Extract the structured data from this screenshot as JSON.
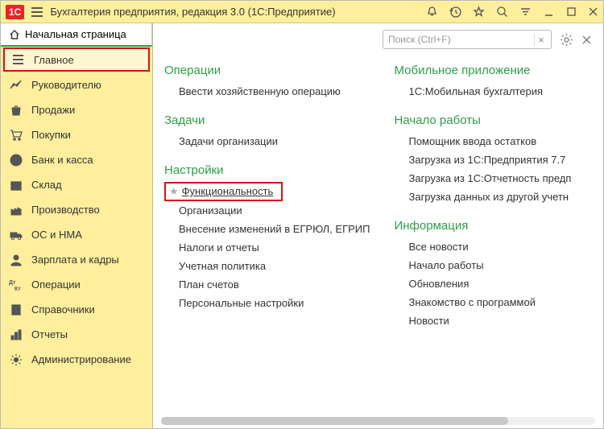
{
  "titlebar": {
    "logo": "1C",
    "title": "Бухгалтерия предприятия, редакция 3.0  (1С:Предприятие)"
  },
  "start_page_label": "Начальная страница",
  "sidebar": {
    "items": [
      {
        "label": "Главное",
        "icon": "menu",
        "active": true
      },
      {
        "label": "Руководителю",
        "icon": "chart"
      },
      {
        "label": "Продажи",
        "icon": "bag"
      },
      {
        "label": "Покупки",
        "icon": "cart"
      },
      {
        "label": "Банк и касса",
        "icon": "ruble"
      },
      {
        "label": "Склад",
        "icon": "box"
      },
      {
        "label": "Производство",
        "icon": "factory"
      },
      {
        "label": "ОС и НМА",
        "icon": "truck"
      },
      {
        "label": "Зарплата и кадры",
        "icon": "person"
      },
      {
        "label": "Операции",
        "icon": "dtkt"
      },
      {
        "label": "Справочники",
        "icon": "book"
      },
      {
        "label": "Отчеты",
        "icon": "report"
      },
      {
        "label": "Администрирование",
        "icon": "gear"
      }
    ]
  },
  "search": {
    "placeholder": "Поиск (Ctrl+F)"
  },
  "content": {
    "left": [
      {
        "title": "Операции",
        "items": [
          "Ввести хозяйственную операцию"
        ]
      },
      {
        "title": "Задачи",
        "items": [
          "Задачи организации"
        ]
      },
      {
        "title": "Настройки",
        "items": [
          "Функциональность",
          "Организации",
          "Внесение изменений в ЕГРЮЛ, ЕГРИП",
          "Налоги и отчеты",
          "Учетная политика",
          "План счетов",
          "Персональные настройки"
        ],
        "highlight_index": 0
      }
    ],
    "right": [
      {
        "title": "Мобильное приложение",
        "items": [
          "1С:Мобильная бухгалтерия"
        ]
      },
      {
        "title": "Начало работы",
        "items": [
          "Помощник ввода остатков",
          "Загрузка из 1С:Предприятия 7.7",
          "Загрузка из 1С:Отчетность предп",
          "Загрузка данных из другой учетн"
        ]
      },
      {
        "title": "Информация",
        "items": [
          "Все новости",
          "Начало работы",
          "Обновления",
          "Знакомство с программой",
          "Новости"
        ]
      }
    ]
  }
}
